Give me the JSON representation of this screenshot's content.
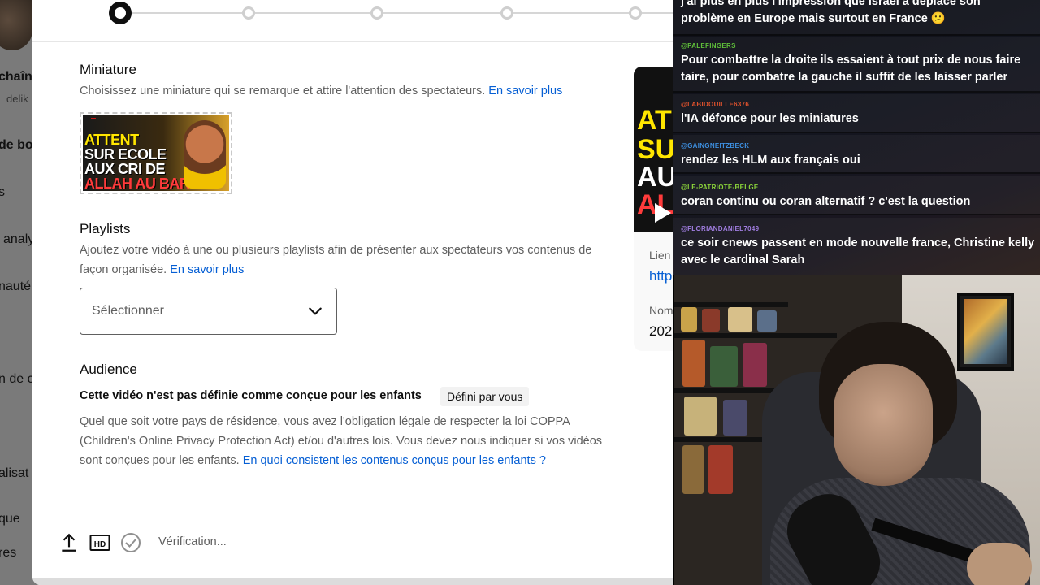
{
  "background": {
    "left_fragments": [
      "chaînc",
      "delik",
      "de bo",
      "s",
      "analy",
      "nauté",
      "n de c",
      "alisat",
      "que",
      "res"
    ]
  },
  "stepper": {
    "steps": 5,
    "active_index": 0
  },
  "miniature": {
    "title": "Miniature",
    "description": "Choisissez une miniature qui se remarque et attire l'attention des spectateurs.",
    "link": "En savoir plus",
    "thumbnail_text": {
      "line1": "ATTENT",
      "line2": "SUR ECOLE",
      "line3": "AUX CRI DE",
      "line4": "ALLAH AU BAR"
    }
  },
  "playlists": {
    "title": "Playlists",
    "description": "Ajoutez votre vidéo à une ou plusieurs playlists afin de présenter aux spectateurs vos contenus de façon organisée.",
    "link": "En savoir plus",
    "select_label": "Sélectionner"
  },
  "audience": {
    "title": "Audience",
    "status_line": "Cette vidéo n'est pas définie comme conçue pour les enfants",
    "chip": "Défini par vous",
    "description": "Quel que soit votre pays de résidence, vous avez l'obligation légale de respecter la loi COPPA (Children's Online Privacy Protection Act) et/ou d'autres lois. Vous devez nous indiquer si vos vidéos sont conçues pour les enfants.",
    "link": "En quoi consistent les contenus conçus pour les enfants ?"
  },
  "footer": {
    "status": "Vérification..."
  },
  "card": {
    "thumb_text": [
      "AT",
      "SU",
      "AU",
      "AL"
    ],
    "link_label": "Lien",
    "link_value": "http",
    "name_label": "Nom",
    "name_value": "202"
  },
  "chat": {
    "messages": [
      {
        "user": "",
        "text": "j'ai plus en plus l'impression que israel a déplacé son problème en Europe mais surtout en France 😕",
        "color": "#ffffff"
      },
      {
        "user": "@PALEFINGERS",
        "text": "Pour combattre la droite ils essaient à tout prix de nous faire taire, pour combatre la gauche il suffit de les laisser parler",
        "color": "#5fbf3a"
      },
      {
        "user": "@LABIDOUILLE6376",
        "text": "l'IA défonce pour les miniatures",
        "color": "#e0522d"
      },
      {
        "user": "@GAINGNEITZBECK",
        "text": "rendez les HLM aux français oui",
        "color": "#3d8fe0"
      },
      {
        "user": "@LE-PATRIOTE-BELGE",
        "text": "coran continu ou coran alternatif ? c'est la question",
        "color": "#8bd43a"
      },
      {
        "user": "@FLORIANDANIEL7049",
        "text": "ce soir cnews passent en mode nouvelle france, Christine kelly avec le cardinal Sarah",
        "color": "#a07de0"
      }
    ]
  }
}
